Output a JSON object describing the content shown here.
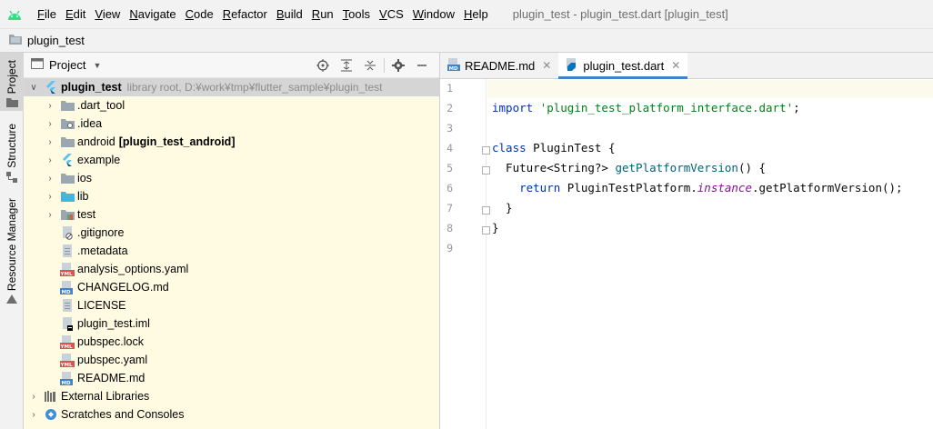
{
  "menubar": {
    "items": [
      {
        "mnemonic": "F",
        "rest": "ile"
      },
      {
        "mnemonic": "E",
        "rest": "dit"
      },
      {
        "mnemonic": "V",
        "rest": "iew"
      },
      {
        "mnemonic": "N",
        "rest": "avigate"
      },
      {
        "mnemonic": "C",
        "rest": "ode"
      },
      {
        "mnemonic": "R",
        "rest": "efactor"
      },
      {
        "mnemonic": "B",
        "rest": "uild"
      },
      {
        "mnemonic": "R",
        "rest": "un"
      },
      {
        "mnemonic": "T",
        "rest": "ools"
      },
      {
        "mnemonic": "V",
        "rest": "CS"
      },
      {
        "mnemonic": "W",
        "rest": "indow"
      },
      {
        "mnemonic": "H",
        "rest": "elp"
      }
    ],
    "window_title": "plugin_test - plugin_test.dart [plugin_test]"
  },
  "navbar": {
    "project": "plugin_test"
  },
  "toolstrip": {
    "project_label": "Project",
    "structure_label": "Structure",
    "resource_label": "Resource Manager"
  },
  "project_panel": {
    "title": "Project",
    "tree": {
      "root": {
        "name": "plugin_test",
        "hint": "library root,  D:¥work¥tmp¥flutter_sample¥plugin_test"
      },
      "items": [
        {
          "name": ".dart_tool",
          "icon": "folder-icon",
          "expandable": true
        },
        {
          "name": ".idea",
          "icon": "idea-folder-icon",
          "expandable": true
        },
        {
          "name": "android",
          "module": "[plugin_test_android]",
          "icon": "folder-icon",
          "expandable": true
        },
        {
          "name": "example",
          "icon": "flutter-icon",
          "expandable": true
        },
        {
          "name": "ios",
          "icon": "folder-icon",
          "expandable": true
        },
        {
          "name": "lib",
          "icon": "source-folder-icon",
          "expandable": true
        },
        {
          "name": "test",
          "icon": "test-folder-icon",
          "expandable": true
        },
        {
          "name": ".gitignore",
          "icon": "gitignore-icon",
          "expandable": false
        },
        {
          "name": ".metadata",
          "icon": "text-file-icon",
          "expandable": false
        },
        {
          "name": "analysis_options.yaml",
          "icon": "yaml-icon",
          "expandable": false
        },
        {
          "name": "CHANGELOG.md",
          "icon": "markdown-icon",
          "expandable": false
        },
        {
          "name": "LICENSE",
          "icon": "text-file-icon",
          "expandable": false
        },
        {
          "name": "plugin_test.iml",
          "icon": "iml-icon",
          "expandable": false
        },
        {
          "name": "pubspec.lock",
          "icon": "yaml-icon",
          "expandable": false
        },
        {
          "name": "pubspec.yaml",
          "icon": "yaml-icon",
          "expandable": false
        },
        {
          "name": "README.md",
          "icon": "markdown-icon",
          "expandable": false
        }
      ],
      "external_libraries": "External Libraries",
      "scratches": "Scratches and Consoles"
    }
  },
  "editor": {
    "tabs": [
      {
        "label": "README.md",
        "active": false
      },
      {
        "label": "plugin_test.dart",
        "active": true
      }
    ],
    "line_numbers": [
      "1",
      "2",
      "3",
      "4",
      "5",
      "6",
      "7",
      "8",
      "9"
    ],
    "code": {
      "l2_kw": "import",
      "l2_str": "'plugin_test_platform_interface.dart'",
      "l2_end": ";",
      "l4_kw": "class",
      "l4_rest": " PluginTest {",
      "l5_type": "  Future<String?> ",
      "l5_fn": "getPlatformVersion",
      "l5_end": "() {",
      "l6_kw": "    return",
      "l6_a": " PluginTestPlatform.",
      "l6_it": "instance",
      "l6_b": ".getPlatformVersion();",
      "l7": "  }",
      "l8": "}"
    }
  }
}
